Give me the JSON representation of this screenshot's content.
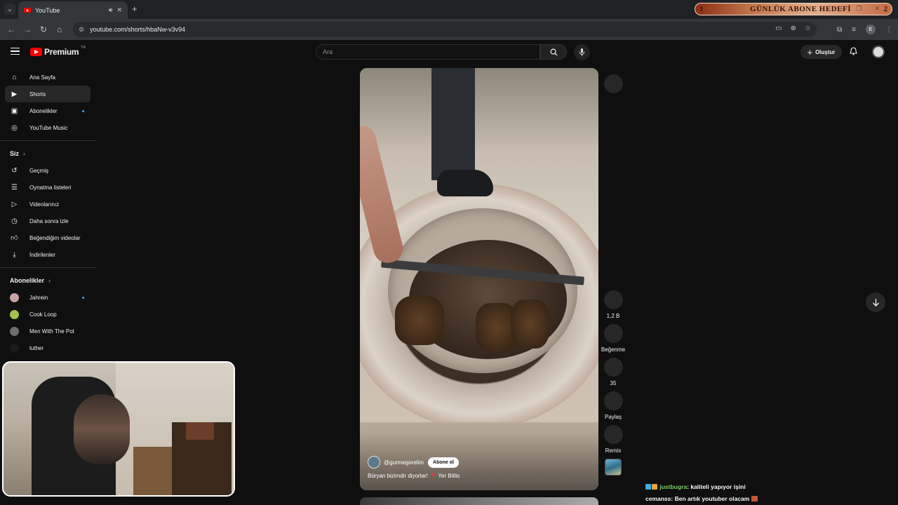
{
  "browser": {
    "tab_title": "YouTube",
    "url": "youtube.com/shorts/hbaNw-v3v94",
    "overlay_goal": {
      "left": "1",
      "title": "GÜNLÜK ABONE HEDEFİ",
      "right": "2"
    }
  },
  "header": {
    "logo_text": "Premium",
    "country_code": "TR",
    "search_placeholder": "Ara",
    "create_label": "Oluştur"
  },
  "sidebar": {
    "main": [
      {
        "label": "Ana Sayfa",
        "icon": "home-icon"
      },
      {
        "label": "Shorts",
        "icon": "shorts-icon",
        "active": true
      },
      {
        "label": "Abonelikler",
        "icon": "subscriptions-icon",
        "dot": true
      },
      {
        "label": "YouTube Music",
        "icon": "music-icon"
      }
    ],
    "you_heading": "Siz",
    "you": [
      {
        "label": "Geçmiş",
        "icon": "history-icon"
      },
      {
        "label": "Oynatma listeleri",
        "icon": "playlists-icon"
      },
      {
        "label": "Videolarınız",
        "icon": "your-videos-icon"
      },
      {
        "label": "Daha sonra izle",
        "icon": "watch-later-icon"
      },
      {
        "label": "Beğendiğim videolar",
        "icon": "liked-icon"
      },
      {
        "label": "İndirilenler",
        "icon": "downloads-icon"
      }
    ],
    "subs_heading": "Abonelikler",
    "subscriptions": [
      {
        "label": "Jahrein",
        "color": "#c9a2a2",
        "dot": true
      },
      {
        "label": "Cook Loop",
        "color": "#a4c24a"
      },
      {
        "label": "Men With The Pot",
        "color": "#6c6f6a"
      },
      {
        "label": "luther",
        "color": "#1a1a1a"
      }
    ]
  },
  "short": {
    "channel": "@gurmegorelim",
    "subscribe_label": "Abone ol",
    "caption": "Büryan bizimdir diyorlar!",
    "location": "Yer Bitlis"
  },
  "actions": {
    "likes": "1,2 B",
    "dislike_label": "Beğenme",
    "comments": "35",
    "share_label": "Paylaş",
    "remix_label": "Remix"
  },
  "chat": [
    {
      "user": "justbugra",
      "message": "kaliteli yapıyor işini"
    },
    {
      "user": "cemanss",
      "message": "Ben artık youtuber olacam"
    }
  ]
}
